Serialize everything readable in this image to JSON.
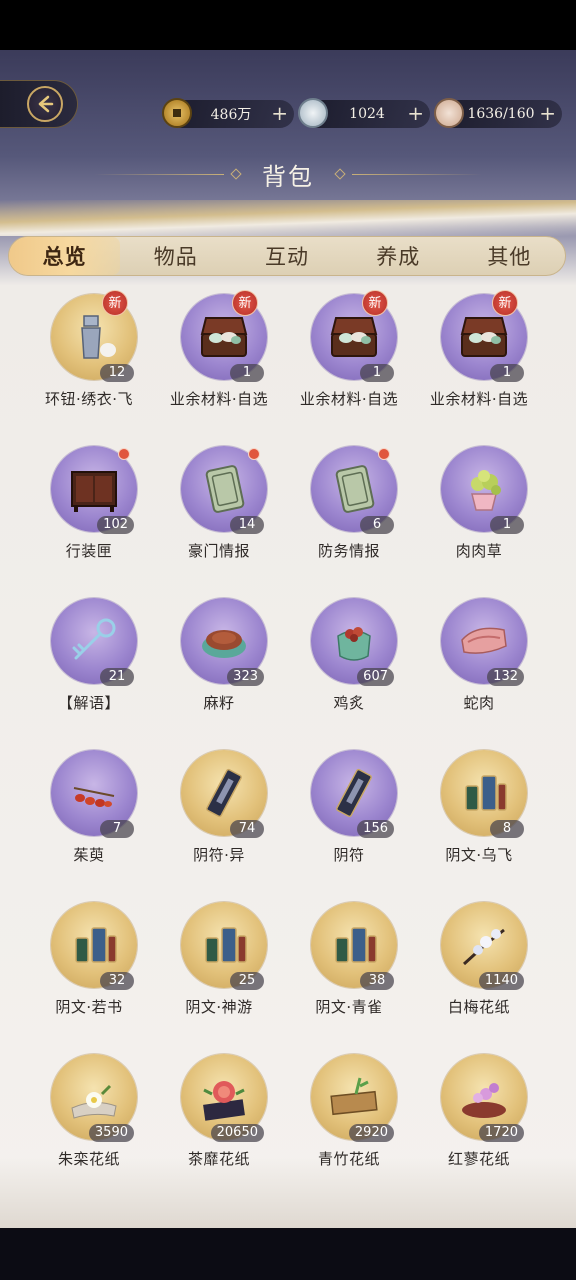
{
  "currencies": [
    {
      "name": "coin",
      "value": "486万",
      "icon": "copper-coin-icon"
    },
    {
      "name": "jade",
      "value": "1024",
      "icon": "jade-orb-icon"
    },
    {
      "name": "stamina",
      "value": "1636/160",
      "icon": "food-bowl-icon"
    }
  ],
  "plus_label": "+",
  "title": "背包",
  "tabs": [
    {
      "label": "总览",
      "active": true
    },
    {
      "label": "物品",
      "active": false
    },
    {
      "label": "互动",
      "active": false
    },
    {
      "label": "养成",
      "active": false
    },
    {
      "label": "其他",
      "active": false
    }
  ],
  "badge_new_label": "新",
  "items": [
    {
      "name": "环钮·绣衣·飞",
      "count": "12",
      "rarity": "gold",
      "badge": "new",
      "icon": "button-ornament-icon"
    },
    {
      "name": "业余材料·自选",
      "count": "1",
      "rarity": "purple",
      "badge": "new",
      "icon": "treasure-chest-icon"
    },
    {
      "name": "业余材料·自选",
      "count": "1",
      "rarity": "purple",
      "badge": "new",
      "icon": "treasure-chest-icon"
    },
    {
      "name": "业余材料·自选",
      "count": "1",
      "rarity": "purple",
      "badge": "new",
      "icon": "treasure-chest-icon"
    },
    {
      "name": "行装匣",
      "count": "102",
      "rarity": "purple",
      "badge": "dot",
      "icon": "cabinet-icon"
    },
    {
      "name": "豪门情报",
      "count": "14",
      "rarity": "purple",
      "badge": "dot",
      "icon": "jade-tablet-icon"
    },
    {
      "name": "防务情报",
      "count": "6",
      "rarity": "purple",
      "badge": "dot",
      "icon": "jade-tablet-icon"
    },
    {
      "name": "肉肉草",
      "count": "1",
      "rarity": "purple",
      "badge": "",
      "icon": "potted-succulent-icon"
    },
    {
      "name": "【解语】",
      "count": "21",
      "rarity": "purple",
      "badge": "",
      "icon": "key-icon"
    },
    {
      "name": "麻籽",
      "count": "323",
      "rarity": "purple",
      "badge": "",
      "icon": "seed-bowl-icon"
    },
    {
      "name": "鸡炙",
      "count": "607",
      "rarity": "purple",
      "badge": "",
      "icon": "food-pouch-icon"
    },
    {
      "name": "蛇肉",
      "count": "132",
      "rarity": "purple",
      "badge": "",
      "icon": "meat-icon"
    },
    {
      "name": "茱萸",
      "count": "7",
      "rarity": "purple",
      "badge": "",
      "icon": "berries-icon"
    },
    {
      "name": "阴符·异",
      "count": "74",
      "rarity": "gold",
      "badge": "",
      "icon": "talisman-scroll-icon"
    },
    {
      "name": "阴符",
      "count": "156",
      "rarity": "purple",
      "badge": "",
      "icon": "talisman-scroll-icon"
    },
    {
      "name": "阴文·乌飞",
      "count": "8",
      "rarity": "gold",
      "badge": "",
      "icon": "thread-spools-icon"
    },
    {
      "name": "阴文·若书",
      "count": "32",
      "rarity": "gold",
      "badge": "",
      "icon": "thread-spools-icon"
    },
    {
      "name": "阴文·神游",
      "count": "25",
      "rarity": "gold",
      "badge": "",
      "icon": "thread-spools-icon"
    },
    {
      "name": "阴文·青雀",
      "count": "38",
      "rarity": "gold",
      "badge": "",
      "icon": "thread-spools-icon"
    },
    {
      "name": "白梅花纸",
      "count": "1140",
      "rarity": "gold",
      "badge": "",
      "icon": "plum-blossom-icon"
    },
    {
      "name": "朱栾花纸",
      "count": "3590",
      "rarity": "gold",
      "badge": "",
      "icon": "white-flower-icon"
    },
    {
      "name": "茶靡花纸",
      "count": "20650",
      "rarity": "gold",
      "badge": "",
      "icon": "red-flower-icon"
    },
    {
      "name": "青竹花纸",
      "count": "2920",
      "rarity": "gold",
      "badge": "",
      "icon": "bamboo-scroll-icon"
    },
    {
      "name": "红蓼花纸",
      "count": "1720",
      "rarity": "gold",
      "badge": "",
      "icon": "pink-flower-icon"
    }
  ],
  "colors": {
    "accent_gold": "#c8af78",
    "rarity_purple": "#9c86cf",
    "rarity_gold": "#e2c17a",
    "badge_red": "#b52e27",
    "text_dark": "#2f2a28"
  }
}
